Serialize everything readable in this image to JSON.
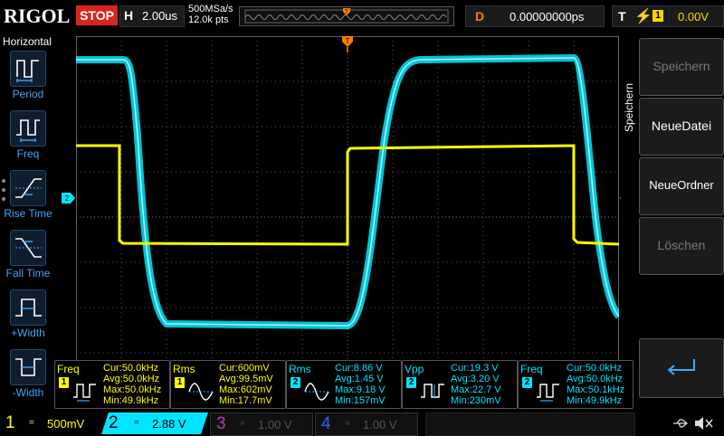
{
  "brand": "RIGOL",
  "run_state": "STOP",
  "timebase": {
    "letter": "H",
    "value": "2.00us"
  },
  "sample": {
    "rate": "500MSa/s",
    "points": "12.0k pts"
  },
  "delay": {
    "letter": "D",
    "value": "0.00000000ps"
  },
  "trigger": {
    "letter": "T",
    "source": "1",
    "level": "0.00V"
  },
  "left_menu": {
    "title": "Horizontal",
    "items": [
      {
        "label": "Period"
      },
      {
        "label": "Freq"
      },
      {
        "label": "Rise Time"
      },
      {
        "label": "Fall Time"
      },
      {
        "label": "+Width"
      },
      {
        "label": "-Width"
      }
    ]
  },
  "right_menu": {
    "title": "Speichern",
    "buttons": [
      {
        "label": "Speichern",
        "enabled": false
      },
      {
        "label": "NeueDatei",
        "enabled": true
      },
      {
        "label": "NeueOrdner",
        "enabled": true
      },
      {
        "label": "Löschen",
        "enabled": false
      }
    ]
  },
  "markers": {
    "ch2_level": "2",
    "trig_level": "T",
    "trig_pos": "T"
  },
  "measurements": [
    {
      "name": "Freq",
      "ch": "1",
      "color": "#ffff00",
      "cur": "Cur:50.0kHz",
      "avg": "Avg:50.0kHz",
      "max": "Max:50.0kHz",
      "min": "Min:49.9kHz"
    },
    {
      "name": "Rms",
      "ch": "1",
      "color": "#ffff00",
      "cur": "Cur:600mV",
      "avg": "Avg:99.5mV",
      "max": "Max:602mV",
      "min": "Min:17.7mV"
    },
    {
      "name": "Rms",
      "ch": "2",
      "color": "#00e5ff",
      "cur": "Cur:8.86 V",
      "avg": "Avg:1.45 V",
      "max": "Max:9.18 V",
      "min": "Min:157mV"
    },
    {
      "name": "Vpp",
      "ch": "2",
      "color": "#00e5ff",
      "cur": "Cur:19.3 V",
      "avg": "Avg:3.20 V",
      "max": "Max:22.7 V",
      "min": "Min:230mV"
    },
    {
      "name": "Freq",
      "ch": "2",
      "color": "#00e5ff",
      "cur": "Cur:50.0kHz",
      "avg": "Avg:50.0kHz",
      "max": "Max:50.1kHz",
      "min": "Min:49.9kHz"
    }
  ],
  "channels": [
    {
      "num": "1",
      "coupling": "=",
      "scale": "500mV",
      "color": "#ffff00",
      "active": true
    },
    {
      "num": "2",
      "coupling": "=",
      "scale": "2.88 V",
      "color": "#00e5ff",
      "active": true
    },
    {
      "num": "3",
      "coupling": "=",
      "scale": "1.00 V",
      "color": "#b040b0",
      "active": false
    },
    {
      "num": "4",
      "coupling": "=",
      "scale": "1.00 V",
      "color": "#3060ff",
      "active": false
    }
  ],
  "colors": {
    "ch1": "#ffff00",
    "ch2": "#00e5ff",
    "trigger": "#ff7f00",
    "menu_text": "#3ea7ff"
  },
  "icons": {
    "usb": "usb-icon",
    "speaker": "speaker-muted-icon",
    "enter": "enter-arrow-icon"
  }
}
